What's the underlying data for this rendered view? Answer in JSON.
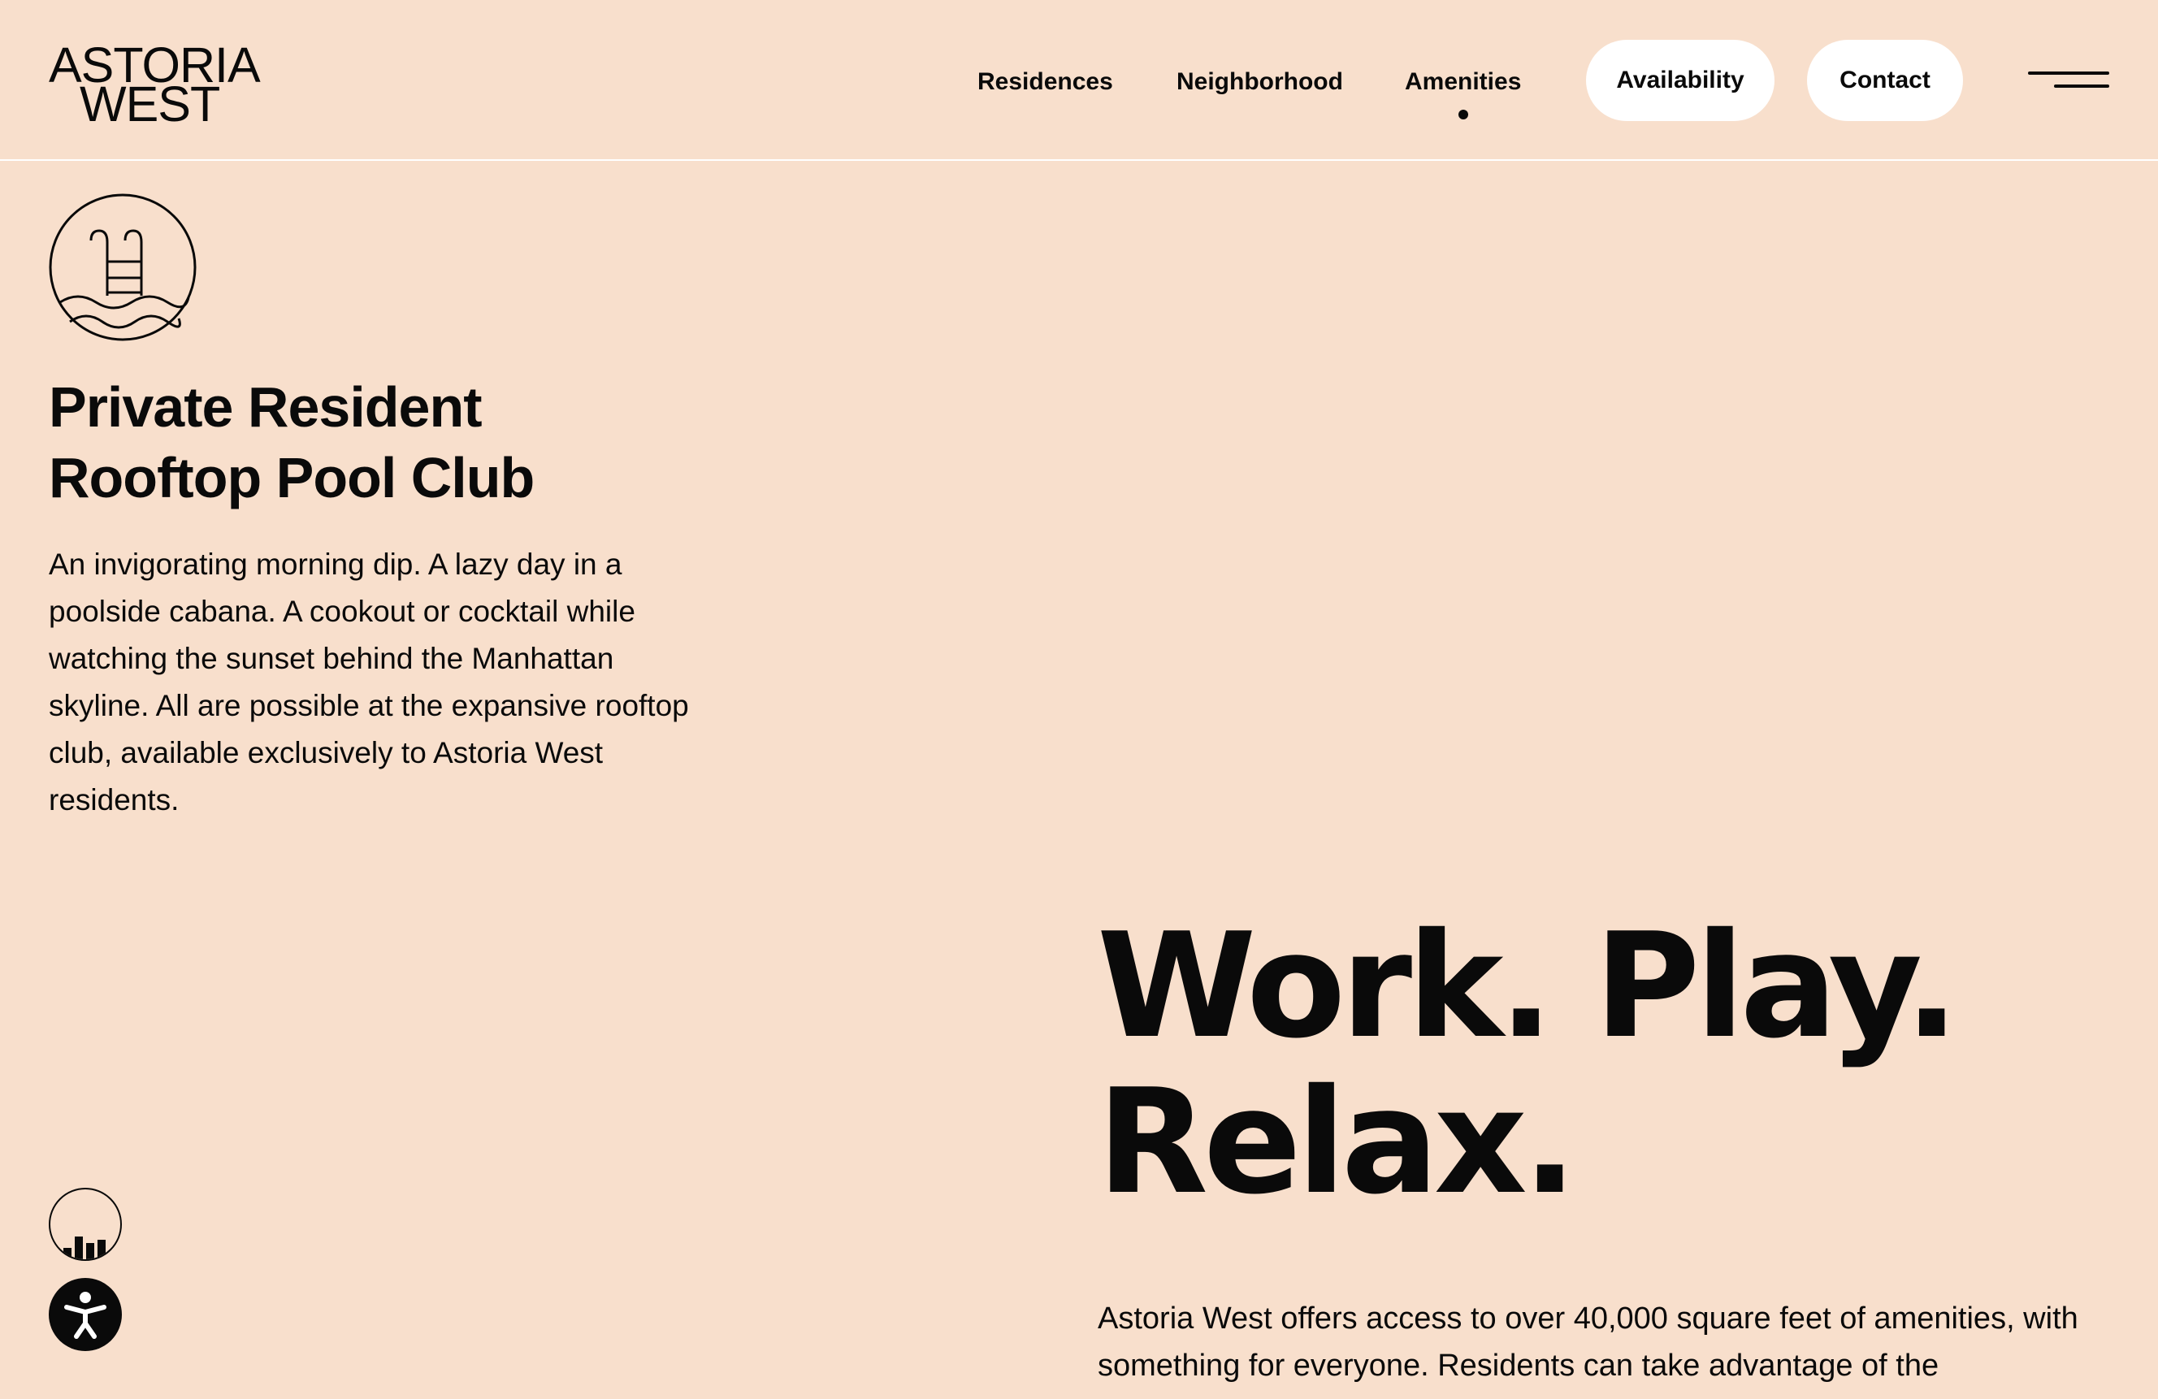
{
  "brand": {
    "logo_line1": "ASTORIA",
    "logo_line2": "WEST"
  },
  "nav": {
    "items": [
      {
        "label": "Residences"
      },
      {
        "label": "Neighborhood"
      },
      {
        "label": "Amenities",
        "active": true
      }
    ],
    "availability_label": "Availability",
    "contact_label": "Contact",
    "menu_icon": "hamburger-menu-icon"
  },
  "pool": {
    "icon": "pool-ladder-icon",
    "title_line1": "Private Resident",
    "title_line2": "Rooftop Pool Club",
    "description": "An invigorating morning dip. A lazy day in a poolside cabana. A cookout or cocktail while watching the sunset behind the Manhattan skyline. All are possible at the expansive rooftop club, available exclusively to Astoria West residents."
  },
  "hero": {
    "title_line1": "Work. Play.",
    "title_line2": "Relax.",
    "description": "Astoria West offers access to over 40,000 square feet of amenities, with something for everyone. Residents can take advantage of the"
  },
  "floating": {
    "chart_icon": "building-chart-icon",
    "accessibility_icon": "accessibility-icon"
  },
  "colors": {
    "background": "#f8dfcc",
    "text": "#0a0a0a",
    "pill_background": "#ffffff"
  }
}
